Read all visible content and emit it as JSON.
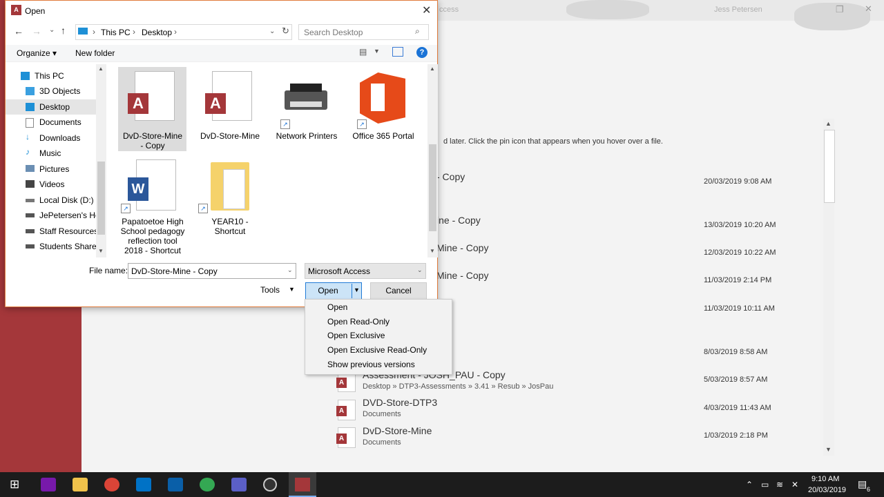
{
  "access": {
    "title": "ccess",
    "user": "Jess Petersen",
    "pin_hint": "d later. Click the pin icon that appears when you hover over a file.",
    "recent": [
      {
        "name": "- Copy",
        "date": "20/03/2019 9:08 AM"
      },
      {
        "name": "ine - Copy",
        "date": "13/03/2019 10:20 AM"
      },
      {
        "name": "Mine - Copy",
        "date": "12/03/2019 10:22 AM"
      },
      {
        "name": "Mine - Copy",
        "date": "11/03/2019 2:14 PM"
      },
      {
        "name": "",
        "date": "11/03/2019 10:11 AM"
      },
      {
        "name": "",
        "date": "8/03/2019 8:58 AM"
      },
      {
        "name": "Assessment - JOSH_PAU - Copy",
        "path": "Desktop » DTP3-Assessments » 3.41 » Resub » JosPau",
        "date": "5/03/2019 8:57 AM"
      },
      {
        "name": "DVD-Store-DTP3",
        "path": "Documents",
        "date": "4/03/2019 11:43 AM"
      },
      {
        "name": "DvD-Store-Mine",
        "path": "Documents",
        "date": "1/03/2019 2:18 PM"
      }
    ]
  },
  "dialog": {
    "title": "Open",
    "app_icon": "A",
    "breadcrumb": {
      "pc": "This PC",
      "desktop": "Desktop"
    },
    "search_placeholder": "Search Desktop",
    "organize": "Organize ▾",
    "new_folder": "New folder",
    "help": "?",
    "nav": [
      {
        "label": "This PC",
        "icon": "pc-icon"
      },
      {
        "label": "3D Objects",
        "icon": "3d-objects-icon"
      },
      {
        "label": "Desktop",
        "icon": "desktop-icon",
        "selected": true
      },
      {
        "label": "Documents",
        "icon": "documents-icon"
      },
      {
        "label": "Downloads",
        "icon": "downloads-icon"
      },
      {
        "label": "Music",
        "icon": "music-icon"
      },
      {
        "label": "Pictures",
        "icon": "pictures-icon"
      },
      {
        "label": "Videos",
        "icon": "videos-icon"
      },
      {
        "label": "Local Disk (D:)",
        "icon": "drive-icon"
      },
      {
        "label": "JePetersen's Hor",
        "icon": "network-drive-icon"
      },
      {
        "label": "Staff Resources (",
        "icon": "network-drive-icon"
      },
      {
        "label": "Students Shared",
        "icon": "network-drive-icon"
      }
    ],
    "files": [
      {
        "label1": "DvD-Store-Mine",
        "label2": "- Copy",
        "icon": "access-file-icon"
      },
      {
        "label1": "DvD-Store-Mine",
        "icon": "access-file-icon"
      },
      {
        "label1": "Network Printers",
        "icon": "printer-icon"
      },
      {
        "label1": "Office 365 Portal",
        "icon": "office-icon"
      },
      {
        "label1": "Papatoetoe High",
        "label2": "School pedagogy",
        "label3": "reflection tool",
        "label4": "2018 - Shortcut",
        "icon": "word-file-icon",
        "word_letter": "W"
      },
      {
        "label1": "YEAR10 -",
        "label2": "Shortcut",
        "icon": "folder-icon"
      }
    ],
    "file_name_label": "File name:",
    "file_name_value": "DvD-Store-Mine - Copy",
    "filter_value": "Microsoft Access",
    "tools": "Tools",
    "open": "Open",
    "cancel": "Cancel",
    "open_menu": [
      "Open",
      "Open Read-Only",
      "Open Exclusive",
      "Open Exclusive Read-Only",
      "Show previous versions"
    ]
  },
  "taskbar": {
    "time": "9:10 AM",
    "date": "20/03/2019",
    "notification_count": "6"
  },
  "colors": {
    "access_red": "#a4373a",
    "accent_blue": "#1a73d6"
  }
}
